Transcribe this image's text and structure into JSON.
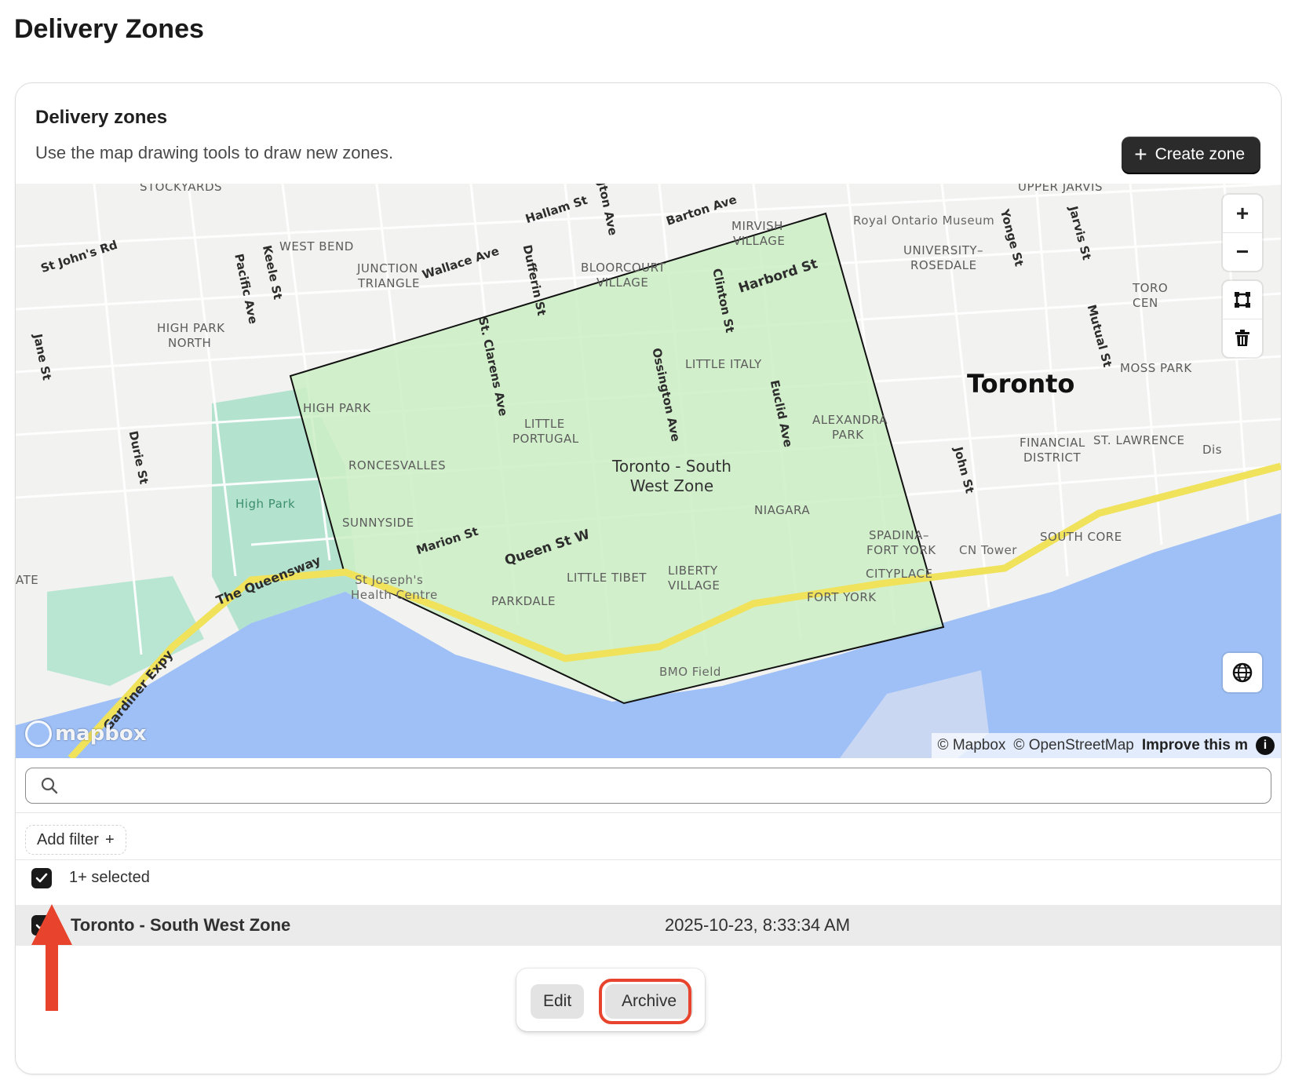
{
  "page": {
    "title": "Delivery Zones"
  },
  "card": {
    "title": "Delivery zones",
    "subtitle": "Use the map drawing tools to draw new zones.",
    "create_button": "Create zone"
  },
  "map": {
    "city_label": "Toronto",
    "zone_label_line1": "Toronto - South",
    "zone_label_line2": "West Zone",
    "neighborhoods": [
      {
        "key": "stockyards",
        "text": "STOCKYARDS"
      },
      {
        "key": "west_bend",
        "text": "WEST BEND"
      },
      {
        "key": "junction_1",
        "text": "JUNCTION"
      },
      {
        "key": "junction_2",
        "text": "TRIANGLE"
      },
      {
        "key": "mirvish_1",
        "text": "MIRVISH"
      },
      {
        "key": "mirvish_2",
        "text": "VILLAGE"
      },
      {
        "key": "bloorcourt_1",
        "text": "BLOORCOURT"
      },
      {
        "key": "bloorcourt_2",
        "text": "VILLAGE"
      },
      {
        "key": "high_park_north_1",
        "text": "HIGH PARK"
      },
      {
        "key": "high_park_north_2",
        "text": "NORTH"
      },
      {
        "key": "little_italy",
        "text": "LITTLE ITALY"
      },
      {
        "key": "high_park",
        "text": "HIGH PARK"
      },
      {
        "key": "little_portugal_1",
        "text": "LITTLE"
      },
      {
        "key": "little_portugal_2",
        "text": "PORTUGAL"
      },
      {
        "key": "alexandra_1",
        "text": "ALEXANDRA"
      },
      {
        "key": "alexandra_2",
        "text": "PARK"
      },
      {
        "key": "roncesvalles",
        "text": "RONCESVALLES"
      },
      {
        "key": "sunnyside",
        "text": "SUNNYSIDE"
      },
      {
        "key": "niagara",
        "text": "NIAGARA"
      },
      {
        "key": "spadina_1",
        "text": "SPADINA–"
      },
      {
        "key": "spadina_2",
        "text": "FORT YORK"
      },
      {
        "key": "cityplace",
        "text": "CITYPLACE"
      },
      {
        "key": "little_tibet",
        "text": "LITTLE TIBET"
      },
      {
        "key": "liberty_1",
        "text": "LIBERTY"
      },
      {
        "key": "liberty_2",
        "text": "VILLAGE"
      },
      {
        "key": "parkdale",
        "text": "PARKDALE"
      },
      {
        "key": "fort_york",
        "text": "FORT YORK"
      },
      {
        "key": "upper_jarvis",
        "text": "UPPER JARVIS"
      },
      {
        "key": "university_1",
        "text": "UNIVERSITY–"
      },
      {
        "key": "university_2",
        "text": "ROSEDALE"
      },
      {
        "key": "financial_1",
        "text": "FINANCIAL"
      },
      {
        "key": "financial_2",
        "text": "DISTRICT"
      },
      {
        "key": "st_lawrence",
        "text": "ST. LAWRENCE"
      },
      {
        "key": "moss_park",
        "text": "MOSS PARK"
      },
      {
        "key": "south_core",
        "text": "SOUTH CORE"
      },
      {
        "key": "toronto_cen_1",
        "text": "TORO"
      },
      {
        "key": "toronto_cen_2",
        "text": "CEN"
      },
      {
        "key": "ate",
        "text": "ATE"
      },
      {
        "key": "dis",
        "text": "Dis"
      }
    ],
    "pois": [
      {
        "key": "rom",
        "text": "Royal Ontario Museum"
      },
      {
        "key": "high_park_poi",
        "text": "High Park"
      },
      {
        "key": "st_joseph_1",
        "text": "St Joseph's"
      },
      {
        "key": "st_joseph_2",
        "text": "Health Centre"
      },
      {
        "key": "cn_tower",
        "text": "CN Tower"
      },
      {
        "key": "bmo_field",
        "text": "BMO Field"
      }
    ],
    "streets": [
      {
        "key": "st_johns",
        "text": "St John's Rd"
      },
      {
        "key": "keele",
        "text": "Keele St"
      },
      {
        "key": "pacific",
        "text": "Pacific Ave"
      },
      {
        "key": "jane",
        "text": "Jane St"
      },
      {
        "key": "wallace",
        "text": "Wallace Ave"
      },
      {
        "key": "dufferin",
        "text": "Dufferin St"
      },
      {
        "key": "hallam",
        "text": "Hallam St"
      },
      {
        "key": "gton",
        "text": "gton Ave"
      },
      {
        "key": "barton",
        "text": "Barton Ave"
      },
      {
        "key": "harbord",
        "text": "Harbord St"
      },
      {
        "key": "clinton",
        "text": "Clinton St"
      },
      {
        "key": "st_clarens",
        "text": "St. Clarens Ave"
      },
      {
        "key": "ossington",
        "text": "Ossington Ave"
      },
      {
        "key": "euclid",
        "text": "Euclid Ave"
      },
      {
        "key": "durie",
        "text": "Durie St"
      },
      {
        "key": "marion",
        "text": "Marion St"
      },
      {
        "key": "queen",
        "text": "Queen St W"
      },
      {
        "key": "queensway",
        "text": "The Queensway"
      },
      {
        "key": "gardiner",
        "text": "Gardiner Expy"
      },
      {
        "key": "yonge",
        "text": "Yonge St"
      },
      {
        "key": "jarvis",
        "text": "Jarvis St"
      },
      {
        "key": "mutual",
        "text": "Mutual St"
      },
      {
        "key": "john",
        "text": "John St"
      }
    ],
    "controls": {
      "zoom_in": "+",
      "zoom_out": "−"
    },
    "attribution": {
      "mapbox": "© Mapbox",
      "osm": "© OpenStreetMap",
      "improve": "Improve this m",
      "info": "i"
    },
    "logo_text": "mapbox",
    "colors": {
      "zone_fill": "#cdeec4",
      "water": "#9fc0f7",
      "park": "#a8dec6",
      "highway": "#f0e25a"
    }
  },
  "search": {
    "value": "",
    "placeholder": ""
  },
  "filter": {
    "add_label": "Add filter",
    "add_icon": "+"
  },
  "selection": {
    "label": "1+ selected"
  },
  "rows": [
    {
      "name": "Toronto - South West Zone",
      "date": "2025-10-23, 8:33:34 AM",
      "selected": true
    }
  ],
  "bulk_actions": {
    "edit": "Edit",
    "archive": "Archive"
  },
  "annotation": {
    "highlight_color": "#e8442d"
  }
}
